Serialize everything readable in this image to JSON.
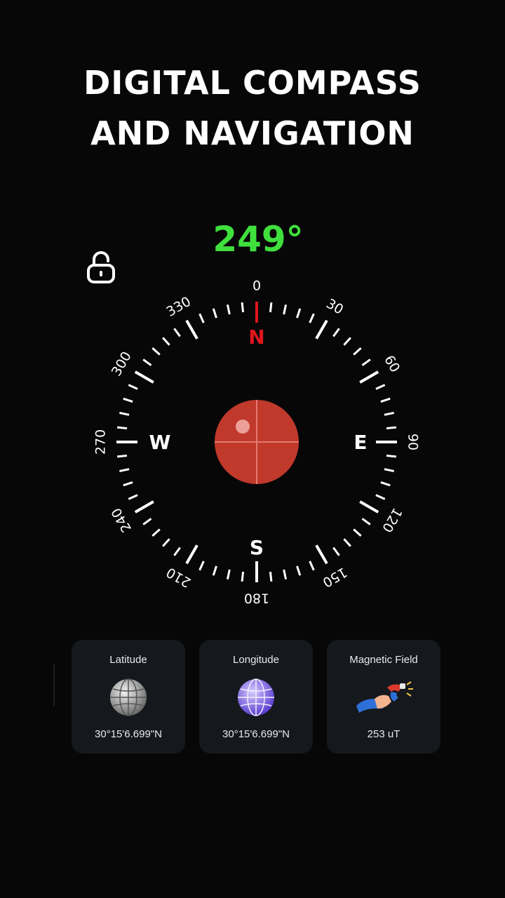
{
  "headline": {
    "line1": "DIGITAL COMPASS",
    "line2": "AND NAVIGATION"
  },
  "heading": {
    "value": "249°",
    "color": "#3fe03c"
  },
  "lock": {
    "icon": "unlock-icon",
    "state": "unlocked"
  },
  "compass": {
    "cardinals": {
      "north": "N",
      "east": "E",
      "south": "S",
      "west": "W"
    },
    "degree_labels": [
      "0",
      "30",
      "60",
      "90",
      "120",
      "150",
      "180",
      "210",
      "240",
      "270",
      "300",
      "330"
    ],
    "north_color": "#e0161d",
    "level_bubble_color": "#c0392b"
  },
  "info_cards": [
    {
      "title": "Latitude",
      "value": "30°15'6.699\"N",
      "icon": "globe-gray-icon"
    },
    {
      "title": "Longitude",
      "value": "30°15'6.699\"N",
      "icon": "globe-purple-icon"
    },
    {
      "title": "Magnetic Field",
      "value": "253 uT",
      "icon": "magnet-hand-icon"
    }
  ]
}
